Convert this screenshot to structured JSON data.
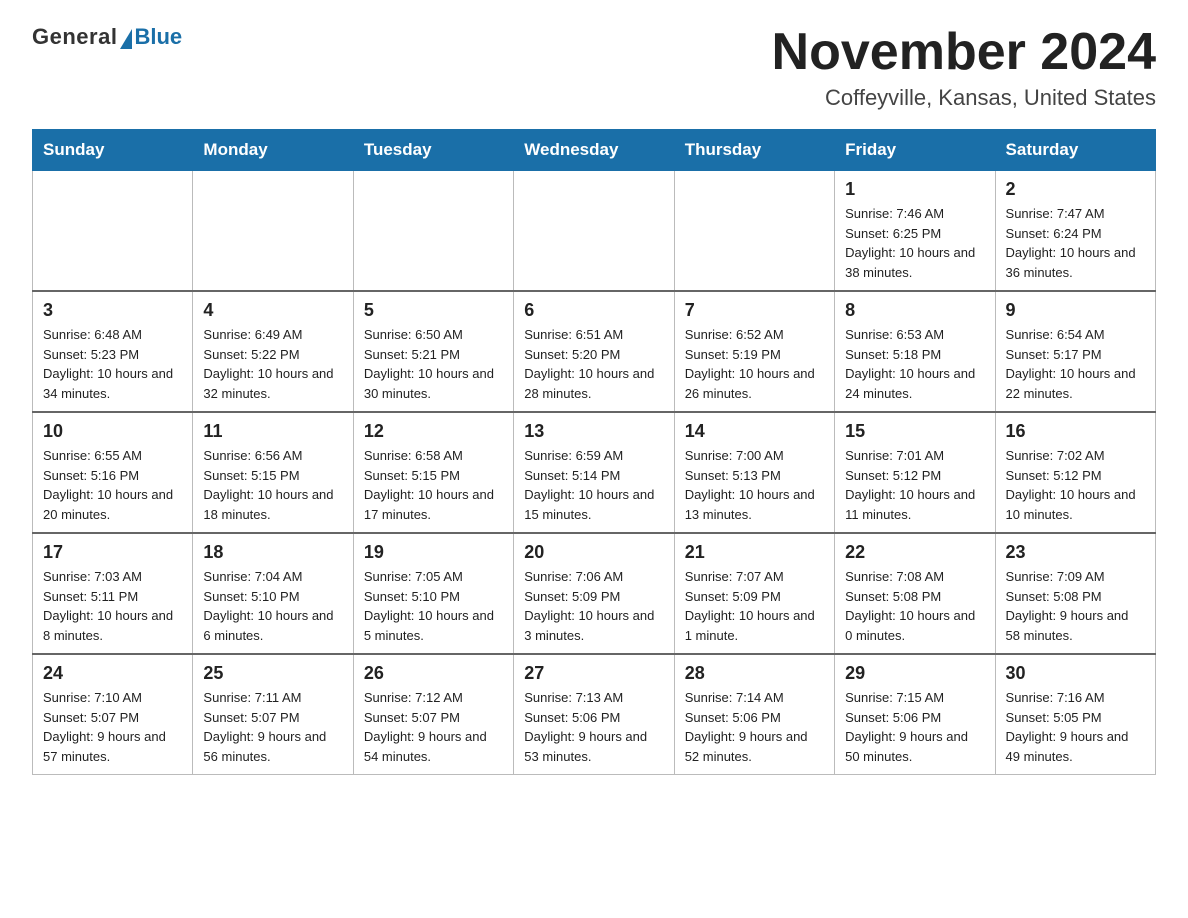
{
  "header": {
    "logo_general": "General",
    "logo_blue": "Blue",
    "main_title": "November 2024",
    "subtitle": "Coffeyville, Kansas, United States"
  },
  "days_of_week": [
    "Sunday",
    "Monday",
    "Tuesday",
    "Wednesday",
    "Thursday",
    "Friday",
    "Saturday"
  ],
  "weeks": [
    {
      "days": [
        {
          "number": "",
          "info": ""
        },
        {
          "number": "",
          "info": ""
        },
        {
          "number": "",
          "info": ""
        },
        {
          "number": "",
          "info": ""
        },
        {
          "number": "",
          "info": ""
        },
        {
          "number": "1",
          "info": "Sunrise: 7:46 AM\nSunset: 6:25 PM\nDaylight: 10 hours and 38 minutes."
        },
        {
          "number": "2",
          "info": "Sunrise: 7:47 AM\nSunset: 6:24 PM\nDaylight: 10 hours and 36 minutes."
        }
      ]
    },
    {
      "days": [
        {
          "number": "3",
          "info": "Sunrise: 6:48 AM\nSunset: 5:23 PM\nDaylight: 10 hours and 34 minutes."
        },
        {
          "number": "4",
          "info": "Sunrise: 6:49 AM\nSunset: 5:22 PM\nDaylight: 10 hours and 32 minutes."
        },
        {
          "number": "5",
          "info": "Sunrise: 6:50 AM\nSunset: 5:21 PM\nDaylight: 10 hours and 30 minutes."
        },
        {
          "number": "6",
          "info": "Sunrise: 6:51 AM\nSunset: 5:20 PM\nDaylight: 10 hours and 28 minutes."
        },
        {
          "number": "7",
          "info": "Sunrise: 6:52 AM\nSunset: 5:19 PM\nDaylight: 10 hours and 26 minutes."
        },
        {
          "number": "8",
          "info": "Sunrise: 6:53 AM\nSunset: 5:18 PM\nDaylight: 10 hours and 24 minutes."
        },
        {
          "number": "9",
          "info": "Sunrise: 6:54 AM\nSunset: 5:17 PM\nDaylight: 10 hours and 22 minutes."
        }
      ]
    },
    {
      "days": [
        {
          "number": "10",
          "info": "Sunrise: 6:55 AM\nSunset: 5:16 PM\nDaylight: 10 hours and 20 minutes."
        },
        {
          "number": "11",
          "info": "Sunrise: 6:56 AM\nSunset: 5:15 PM\nDaylight: 10 hours and 18 minutes."
        },
        {
          "number": "12",
          "info": "Sunrise: 6:58 AM\nSunset: 5:15 PM\nDaylight: 10 hours and 17 minutes."
        },
        {
          "number": "13",
          "info": "Sunrise: 6:59 AM\nSunset: 5:14 PM\nDaylight: 10 hours and 15 minutes."
        },
        {
          "number": "14",
          "info": "Sunrise: 7:00 AM\nSunset: 5:13 PM\nDaylight: 10 hours and 13 minutes."
        },
        {
          "number": "15",
          "info": "Sunrise: 7:01 AM\nSunset: 5:12 PM\nDaylight: 10 hours and 11 minutes."
        },
        {
          "number": "16",
          "info": "Sunrise: 7:02 AM\nSunset: 5:12 PM\nDaylight: 10 hours and 10 minutes."
        }
      ]
    },
    {
      "days": [
        {
          "number": "17",
          "info": "Sunrise: 7:03 AM\nSunset: 5:11 PM\nDaylight: 10 hours and 8 minutes."
        },
        {
          "number": "18",
          "info": "Sunrise: 7:04 AM\nSunset: 5:10 PM\nDaylight: 10 hours and 6 minutes."
        },
        {
          "number": "19",
          "info": "Sunrise: 7:05 AM\nSunset: 5:10 PM\nDaylight: 10 hours and 5 minutes."
        },
        {
          "number": "20",
          "info": "Sunrise: 7:06 AM\nSunset: 5:09 PM\nDaylight: 10 hours and 3 minutes."
        },
        {
          "number": "21",
          "info": "Sunrise: 7:07 AM\nSunset: 5:09 PM\nDaylight: 10 hours and 1 minute."
        },
        {
          "number": "22",
          "info": "Sunrise: 7:08 AM\nSunset: 5:08 PM\nDaylight: 10 hours and 0 minutes."
        },
        {
          "number": "23",
          "info": "Sunrise: 7:09 AM\nSunset: 5:08 PM\nDaylight: 9 hours and 58 minutes."
        }
      ]
    },
    {
      "days": [
        {
          "number": "24",
          "info": "Sunrise: 7:10 AM\nSunset: 5:07 PM\nDaylight: 9 hours and 57 minutes."
        },
        {
          "number": "25",
          "info": "Sunrise: 7:11 AM\nSunset: 5:07 PM\nDaylight: 9 hours and 56 minutes."
        },
        {
          "number": "26",
          "info": "Sunrise: 7:12 AM\nSunset: 5:07 PM\nDaylight: 9 hours and 54 minutes."
        },
        {
          "number": "27",
          "info": "Sunrise: 7:13 AM\nSunset: 5:06 PM\nDaylight: 9 hours and 53 minutes."
        },
        {
          "number": "28",
          "info": "Sunrise: 7:14 AM\nSunset: 5:06 PM\nDaylight: 9 hours and 52 minutes."
        },
        {
          "number": "29",
          "info": "Sunrise: 7:15 AM\nSunset: 5:06 PM\nDaylight: 9 hours and 50 minutes."
        },
        {
          "number": "30",
          "info": "Sunrise: 7:16 AM\nSunset: 5:05 PM\nDaylight: 9 hours and 49 minutes."
        }
      ]
    }
  ]
}
